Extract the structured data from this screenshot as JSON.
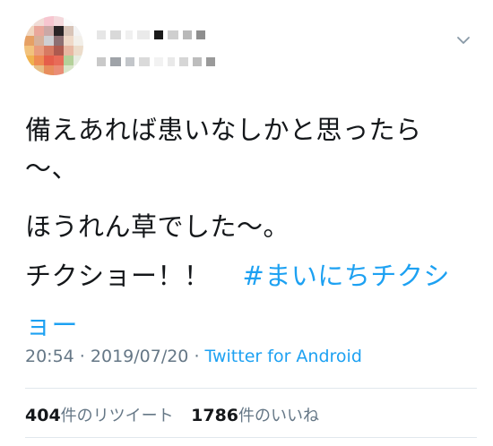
{
  "header": {
    "avatar_icon": "blurred-avatar-icon",
    "menu_icon": "chevron-down-icon"
  },
  "body": {
    "line1": "備えあれば患いなしかと思ったら",
    "line2": "〜、",
    "line3": "ほうれん草でした〜。",
    "line4_text": "チクショー！！",
    "hashtag_part1": "#まいにちチクシ",
    "hashtag_part2": "ョー"
  },
  "meta": {
    "time": "20:54",
    "sep1": " · ",
    "date": "2019/07/20",
    "sep2": " · ",
    "source": "Twitter for Android"
  },
  "stats": {
    "retweet_count": "404",
    "retweet_label": "件のリツイート",
    "like_count": "1786",
    "like_label": "件のいいね"
  },
  "colors": {
    "text": "#14171a",
    "secondary": "#657786",
    "link": "#1da1f2",
    "divider": "#e1e8ed"
  }
}
